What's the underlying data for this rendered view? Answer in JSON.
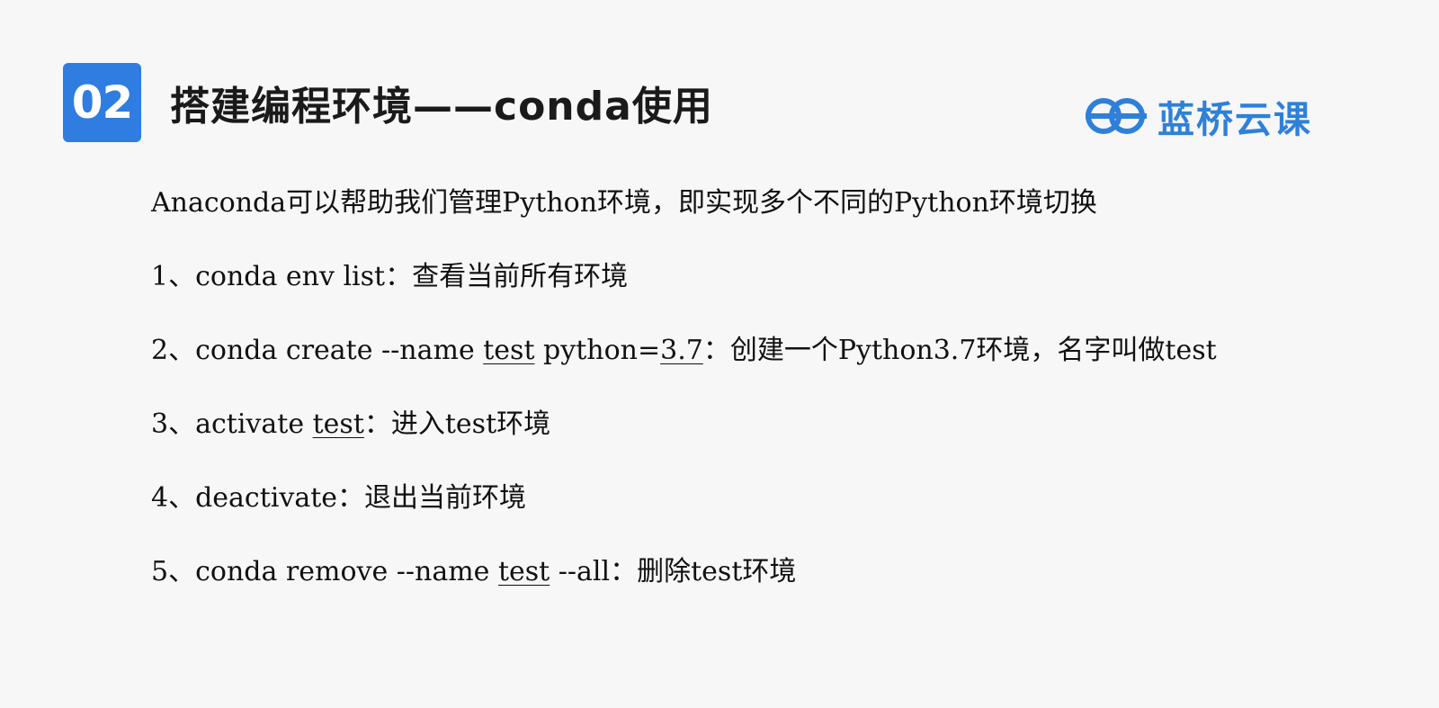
{
  "header": {
    "badge": "02",
    "title": "搭建编程环境——conda使用"
  },
  "logo": {
    "text": "蓝桥云课",
    "icon": "lanqiao-logo-icon"
  },
  "colors": {
    "accent": "#2f7de1",
    "logo": "#2f80d8",
    "background": "#f7f7f7",
    "text": "#111111"
  },
  "content": {
    "intro": "Anaconda可以帮助我们管理Python环境，即实现多个不同的Python环境切换",
    "line1": "1、conda env list：查看当前所有环境",
    "line2": {
      "prefix": "2、conda create --name ",
      "u1": "test",
      "mid": " python=",
      "u2": "3.7",
      "suffix": "：创建一个Python3.7环境，名字叫做test"
    },
    "line3": {
      "prefix": "3、activate ",
      "u1": "test",
      "suffix": "：进入test环境"
    },
    "line4": "4、deactivate：退出当前环境",
    "line5": {
      "prefix": "5、conda remove --name ",
      "u1": "test",
      "suffix": " --all：删除test环境"
    }
  }
}
